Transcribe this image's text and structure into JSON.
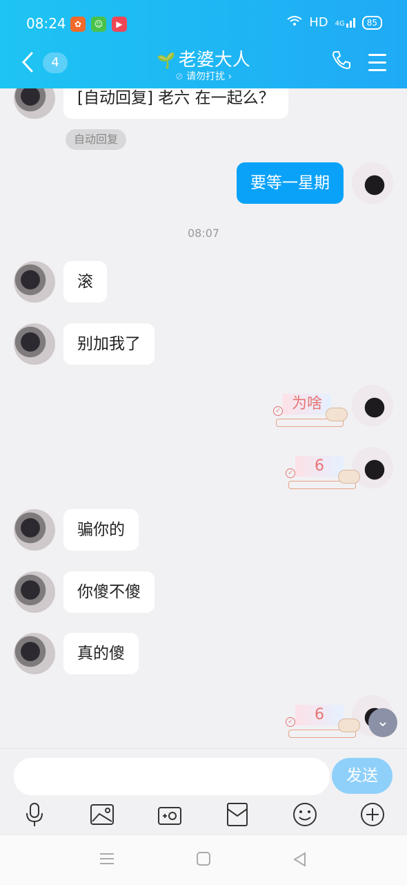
{
  "status_bar": {
    "time": "08:24",
    "network": "HD",
    "signal": "4G",
    "battery": "85",
    "icons": [
      "app-icon-orange",
      "app-icon-green",
      "app-icon-red",
      "wifi-icon",
      "signal-icon",
      "battery-icon"
    ]
  },
  "header": {
    "back_count": "4",
    "contact_name": "老婆大人",
    "dnd_text": "请勿打扰 ›",
    "icons": [
      "back-icon",
      "sprout-icon",
      "phone-icon",
      "menu-icon"
    ]
  },
  "messages": [
    {
      "side": "left",
      "text": "[自动回复] 老六 在一起么？"
    },
    {
      "side": "left_tag",
      "text": "自动回复"
    },
    {
      "side": "right",
      "text": "要等一星期"
    },
    {
      "side": "time",
      "text": "08:07"
    },
    {
      "side": "left",
      "text": "滚"
    },
    {
      "side": "left",
      "text": "别加我了"
    },
    {
      "side": "right_sticker",
      "text": "为啥"
    },
    {
      "side": "right_sticker",
      "text": "6"
    },
    {
      "side": "left",
      "text": "骗你的"
    },
    {
      "side": "left",
      "text": "你傻不傻"
    },
    {
      "side": "left",
      "text": "真的傻"
    },
    {
      "side": "right_sticker",
      "text": "6"
    }
  ],
  "composer": {
    "placeholder": "",
    "send_label": "发送",
    "tools": [
      "mic-icon",
      "image-icon",
      "camera-icon",
      "red-packet-icon",
      "emoji-icon",
      "plus-icon"
    ]
  },
  "system_nav": [
    "recent-apps-icon",
    "home-icon",
    "back-nav-icon"
  ],
  "colors": {
    "header": "#1fb7f5",
    "my_bubble": "#0aa2f9",
    "send_button": "#8fd0fa",
    "chat_bg": "#f1f1f3"
  }
}
